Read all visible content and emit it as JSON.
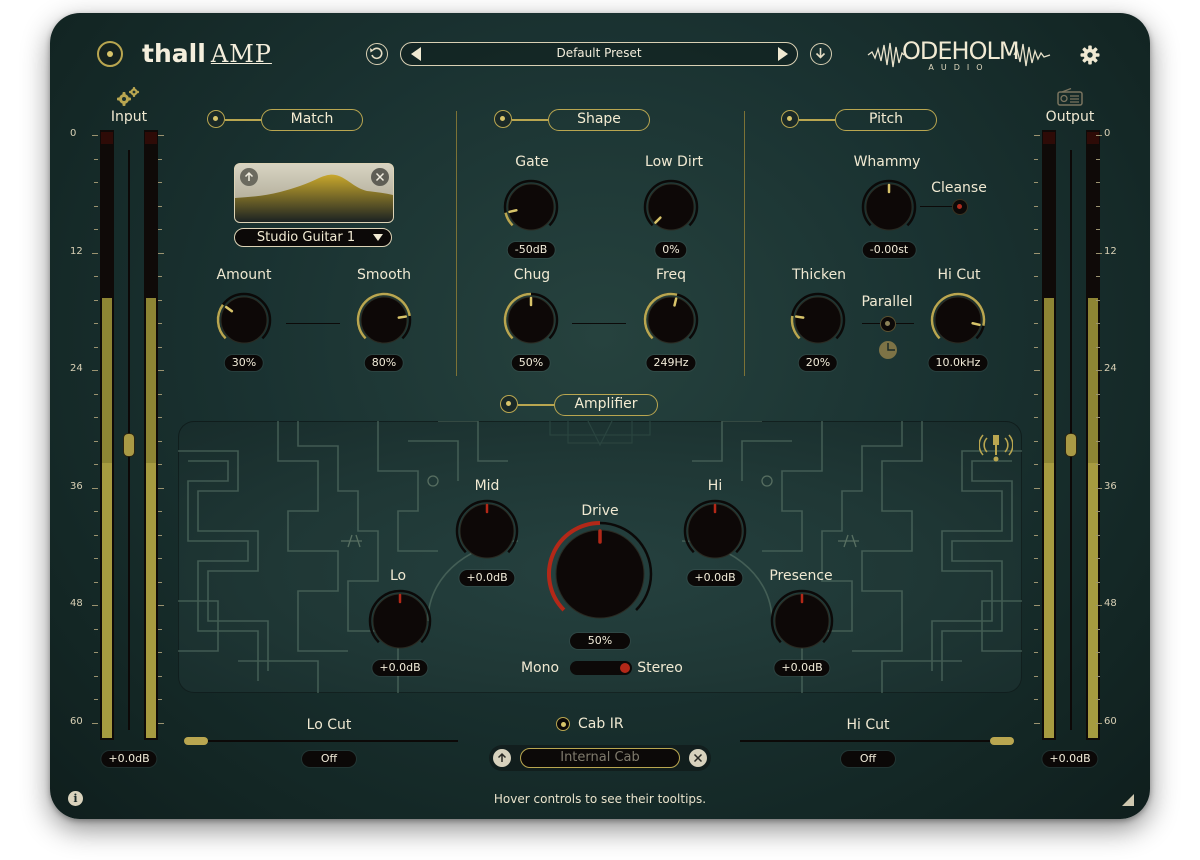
{
  "header": {
    "brand_main": "thall",
    "brand_amp": "AMP",
    "preset_name": "Default Preset",
    "company": "ODEHOLM",
    "company_sub": "AUDIO"
  },
  "input": {
    "label": "Input",
    "value": "+0.0dB",
    "level": 0.75,
    "peak": 0.47
  },
  "output": {
    "label": "Output",
    "value": "+0.0dB",
    "level": 0.75,
    "peak": 0.47
  },
  "meter_scale": [
    "0",
    "12",
    "24",
    "36",
    "48",
    "60"
  ],
  "match": {
    "section": "Match",
    "profile": "Studio Guitar 1",
    "amount": {
      "label": "Amount",
      "value": "30%"
    },
    "smooth": {
      "label": "Smooth",
      "value": "80%"
    }
  },
  "shape": {
    "section": "Shape",
    "gate": {
      "label": "Gate",
      "value": "-50dB"
    },
    "low_dirt": {
      "label": "Low Dirt",
      "value": "0%"
    },
    "chug": {
      "label": "Chug",
      "value": "50%"
    },
    "freq": {
      "label": "Freq",
      "value": "249Hz"
    }
  },
  "pitch": {
    "section": "Pitch",
    "whammy": {
      "label": "Whammy",
      "value": "-0.00st"
    },
    "cleanse": "Cleanse",
    "thicken": {
      "label": "Thicken",
      "value": "20%"
    },
    "parallel": "Parallel",
    "hi_cut": {
      "label": "Hi Cut",
      "value": "10.0kHz"
    }
  },
  "amplifier": {
    "section": "Amplifier",
    "mid": {
      "label": "Mid",
      "value": "+0.0dB"
    },
    "hi": {
      "label": "Hi",
      "value": "+0.0dB"
    },
    "drive": {
      "label": "Drive",
      "value": "50%"
    },
    "lo": {
      "label": "Lo",
      "value": "+0.0dB"
    },
    "presence": {
      "label": "Presence",
      "value": "+0.0dB"
    },
    "mono": "Mono",
    "stereo": "Stereo"
  },
  "bottom": {
    "lo_cut": {
      "label": "Lo Cut",
      "value": "Off"
    },
    "hi_cut": {
      "label": "Hi Cut",
      "value": "Off"
    },
    "cab_ir": "Cab IR",
    "cab_name": "Internal Cab",
    "status": "Hover controls to see their tooltips."
  },
  "colors": {
    "accent": "#b9a650",
    "meter": "#a79b40",
    "drive_arc": "#b32818",
    "panel": "#1a3231"
  }
}
